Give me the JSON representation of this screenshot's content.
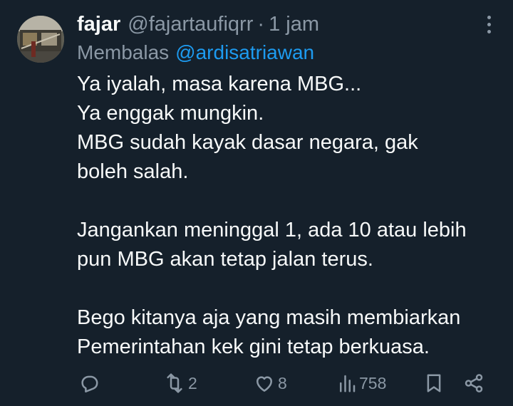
{
  "author": {
    "name": "fajar",
    "handle": "@fajartaufiqrr",
    "separator": "·",
    "time": "1 jam"
  },
  "reply": {
    "prefix": "Membalas",
    "mention": "@ardisatriawan"
  },
  "body_lines": [
    "Ya iyalah, masa karena MBG...",
    "Ya enggak mungkin.",
    "MBG sudah kayak dasar negara, gak",
    "boleh salah.",
    "",
    "Jangankan meninggal 1, ada 10 atau lebih",
    "pun MBG akan tetap jalan terus.",
    "",
    "Bego kitanya aja yang masih membiarkan",
    "Pemerintahan kek gini tetap berkuasa."
  ],
  "actions": {
    "reply": {
      "icon": "reply-icon"
    },
    "retweet": {
      "icon": "retweet-icon",
      "count": "2"
    },
    "like": {
      "icon": "heart-icon",
      "count": "8"
    },
    "views": {
      "icon": "views-icon",
      "count": "758"
    },
    "bookmark": {
      "icon": "bookmark-icon"
    },
    "share": {
      "icon": "share-icon"
    }
  },
  "colors": {
    "background": "#15202b",
    "text": "#f7f9f9",
    "muted": "#8b98a5",
    "accent": "#1d9bf0"
  }
}
